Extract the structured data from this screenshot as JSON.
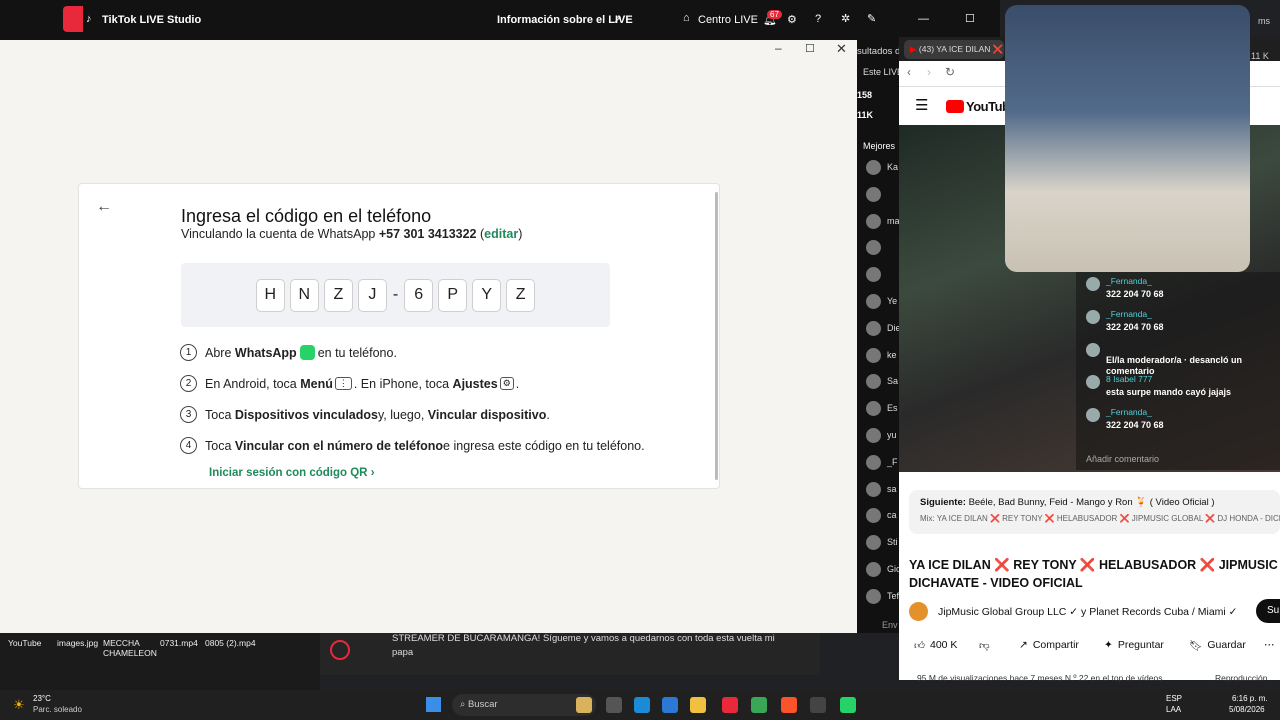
{
  "tiktok": {
    "app_title": "TikTok LIVE Studio",
    "live_info": "Información sobre el LIVE",
    "live_center": "Centro LIVE",
    "notif_count": "67"
  },
  "whatsapp": {
    "title": "Ingresa el código en el teléfono",
    "subtitle_prefix": "Vinculando la cuenta de WhatsApp ",
    "phone": "+57 301 3413322",
    "edit": "editar",
    "code": [
      "H",
      "N",
      "Z",
      "J",
      "6",
      "P",
      "Y",
      "Z"
    ],
    "code_sep": "-",
    "steps": [
      {
        "n": "1",
        "a": "Abre ",
        "b": "WhatsApp",
        "c": " en tu teléfono."
      },
      {
        "n": "2",
        "a": "En Android, toca ",
        "b": "Menú",
        "c": ". En iPhone, toca ",
        "d": "Ajustes",
        "e": "."
      },
      {
        "n": "3",
        "a": "Toca ",
        "b": "Dispositivos vinculados",
        "c": " y, luego, ",
        "d": "Vincular dispositivo",
        "e": "."
      },
      {
        "n": "4",
        "a": "Toca ",
        "b": "Vincular con el número de teléfono",
        "c": " e ingresa este código en tu teléfono."
      }
    ],
    "qr_link": "Iniciar sesión con código QR"
  },
  "stream_panel": {
    "results": "sultados d",
    "este_live": "Este LIVE",
    "stat1": "158",
    "stat2": "11K",
    "best": "Mejores",
    "viewers": [
      "Ka",
      "",
      "ma",
      "",
      "",
      "Ye",
      "Die",
      "ke",
      "Sa",
      "Es",
      "yu",
      "_F",
      "sa",
      "ca",
      "Sti",
      "Gio",
      "Tef"
    ],
    "right_stat": "11 K",
    "ms": "ms"
  },
  "chat": [
    {
      "name": "_Fernanda_",
      "msg": "322 204 70 68"
    },
    {
      "name": "_Fernanda_",
      "msg": "322 204 70 68"
    },
    {
      "name": "",
      "msg": "El/la moderador/a   ·   desancló un comentario"
    },
    {
      "name": "8   Isabel 777",
      "msg": "esta surpe mando cayó jajajs"
    },
    {
      "name": "_Fernanda_",
      "msg": "322 204 70 68"
    }
  ],
  "chat_input": "Añadir comentario",
  "youtube": {
    "tab_title": "(43) YA ICE DILAN",
    "logo": "YouTube",
    "next_label": "Siguiente:",
    "next_title": "Beéle, Bad Bunny, Feid - Mango y Ron",
    "next_suffix": "( Video Oficial )",
    "mix": "Mix: YA ICE DILAN ❌ REY TONY ❌ HELABUSADOR ❌ JIPMUSIC GLOBAL ❌ DJ HONDA - DICHA",
    "video_title_1": "YA ICE DILAN ❌ REY TONY ❌ HELABUSADOR ❌ JIPMUSIC",
    "video_title_2": "DICHAVATE - VIDEO OFICIAL",
    "channel": "JipMusic Global Group LLC",
    "channel_2": "y Planet Records Cuba / Miami",
    "subscribe": "Su",
    "likes": "400 K",
    "share": "Compartir",
    "ask": "Preguntar",
    "save": "Guardar",
    "views": "95 M de visualizaciones  hace 7 meses   N.º 22 en el top de vídeos",
    "repro": "Reproducción"
  },
  "bottom": {
    "streamer_msg": "STREAMER DE BUCARAMANGA! Sígueme y vamos a quedarnos con toda esta vuelta mi papa",
    "envia": "Env",
    "desktop_files": [
      "YouTube",
      "images.jpg",
      "MECCHA CHAMELEON",
      "0731.mp4",
      "0805 (2).mp4"
    ]
  },
  "taskbar": {
    "temp": "23°C",
    "weather": "Parc. soleado",
    "search": "Buscar",
    "lang1": "ESP",
    "lang2": "LAA",
    "time": "6:16 p. m.",
    "date": "5/08/2026"
  },
  "colors": {
    "wa_green": "#25d366",
    "link_green": "#1f8a5b",
    "yt_red": "#ff0000"
  }
}
